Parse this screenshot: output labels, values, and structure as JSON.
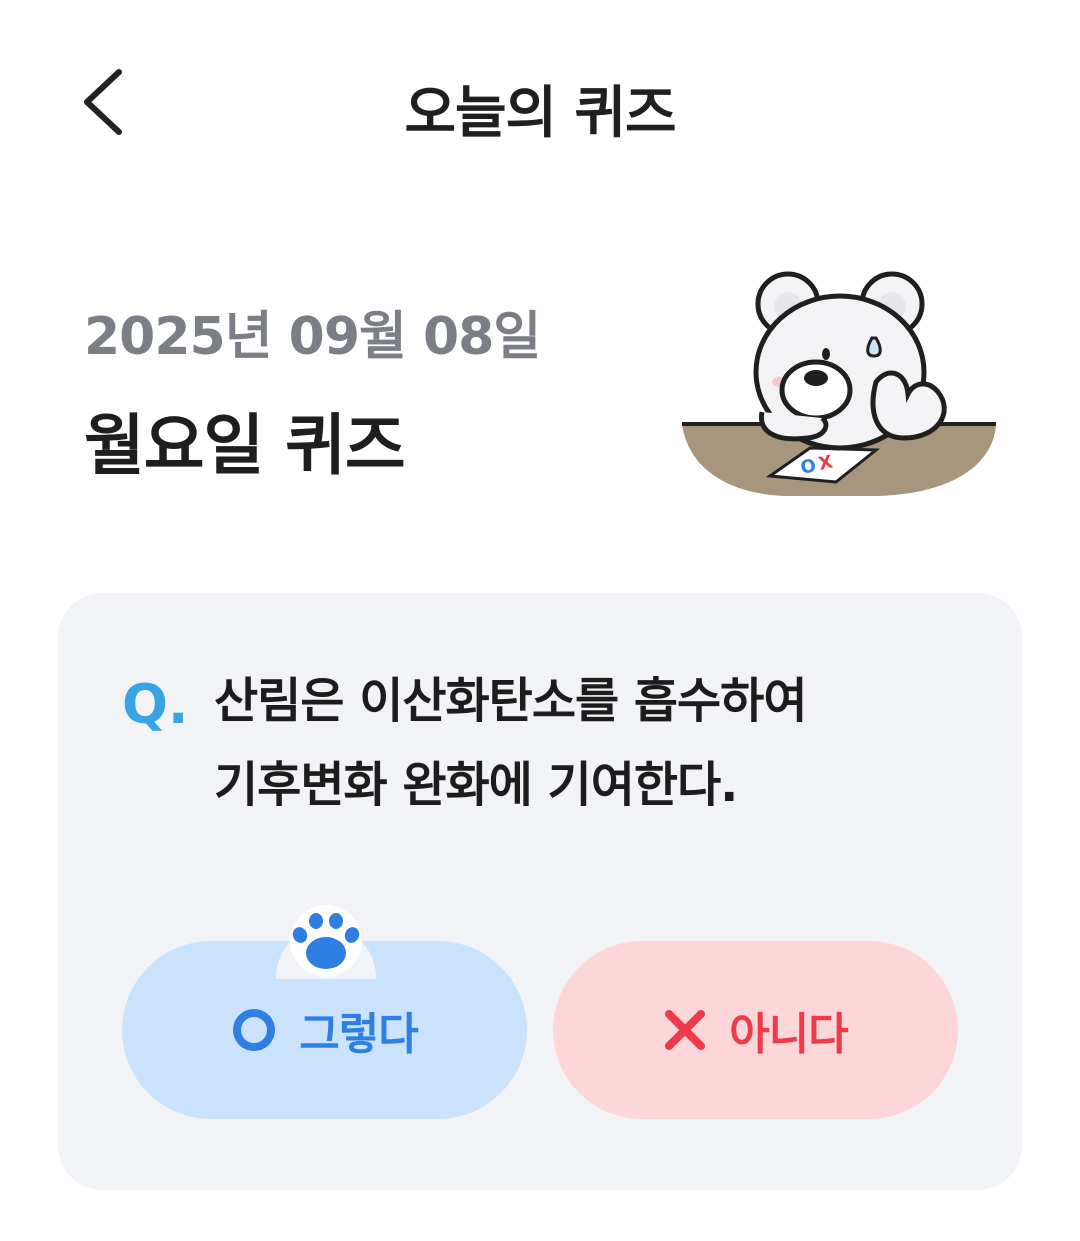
{
  "header": {
    "title": "오늘의 퀴즈",
    "back_icon": "chevron-left-icon"
  },
  "quiz": {
    "date": "2025년 09월 08일",
    "day_title": "월요일 퀴즈",
    "mascot": "polar-bear-with-ox-card",
    "question_marker": "Q.",
    "question_lines": [
      "산림은 이산화탄소를 흡수하여",
      "기후변화 완화에 기여한다."
    ],
    "answers": {
      "yes": {
        "label": "그렇다",
        "icon": "circle-o-icon",
        "color": "#2f7ee2",
        "bg": "#cbe2fd"
      },
      "no": {
        "label": "아니다",
        "icon": "x-mark-icon",
        "color": "#ef3a4a",
        "bg": "#fdd6d9"
      }
    },
    "selection_indicator": "paw-icon"
  }
}
